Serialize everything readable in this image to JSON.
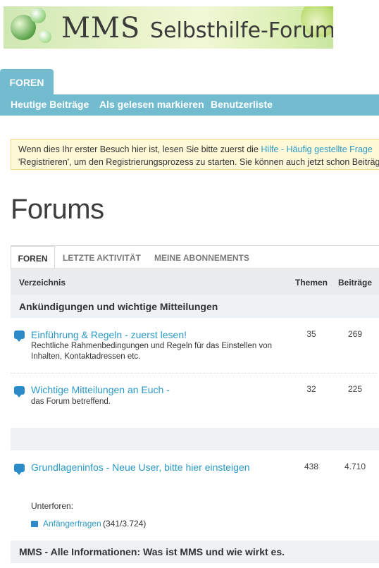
{
  "banner": {
    "title_main": "MMS",
    "title_sub": "Selbsthilfe-Forum"
  },
  "nav": {
    "tab": "FOREN",
    "links": [
      "Heutige Beiträge",
      "Als gelesen markieren",
      "Benutzerliste"
    ]
  },
  "notice": {
    "line1_text": "Wenn dies Ihr erster Besuch hier ist, lesen Sie bitte zuerst die ",
    "line1_link": "Hilfe - Häufig gestellte Frage",
    "line2_text": "'Registrieren', um den Registrierungsprozess zu starten. Sie können auch jetzt schon Beiträg"
  },
  "page": {
    "title": "Forums"
  },
  "tabs": [
    "FOREN",
    "LETZTE AKTIVITÄT",
    "MEINE ABONNEMENTS"
  ],
  "columns": {
    "directory": "Verzeichnis",
    "topics": "Themen",
    "posts": "Beiträge"
  },
  "sections": [
    {
      "title": "Ankündigungen und wichtige Mitteilungen",
      "forums": [
        {
          "title": "Einführung & Regeln - zuerst lesen!",
          "desc": "Rechtliche Rahmenbedingungen und Regeln für das Einstellen von Inhalten, Kontaktadressen etc.",
          "topics": "35",
          "posts": "269"
        },
        {
          "title": "Wichtige Mitteilungen an Euch -",
          "desc": "das Forum betreffend.",
          "topics": "32",
          "posts": "225"
        }
      ]
    },
    {
      "title": "",
      "forums": [
        {
          "title": "Grundlageninfos - Neue User, bitte hier einsteigen",
          "desc": "",
          "topics": "438",
          "posts": "4.710",
          "subforums_label": "Unterforen:",
          "subforums": [
            {
              "name": "Anfängerfragen",
              "count": "(341/3.724)"
            }
          ]
        }
      ]
    },
    {
      "title": "MMS - Alle Informationen: Was ist MMS und wie wirkt es."
    }
  ],
  "colors": {
    "accent": "#73bbce",
    "link": "#2a9ac6",
    "notice_bg": "#fff9d8",
    "section_bg": "#eef2f4"
  }
}
